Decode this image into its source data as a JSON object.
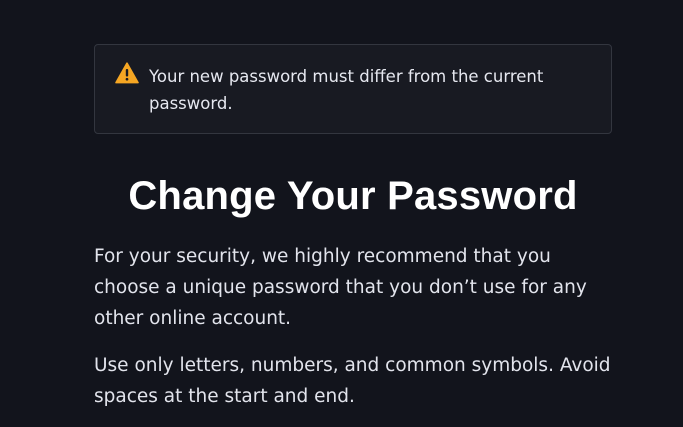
{
  "alert": {
    "icon": "warning-triangle-icon",
    "icon_color": "#f5a623",
    "message": "Your new password must differ from the current password."
  },
  "heading": {
    "title": "Change Your Password"
  },
  "body": {
    "paragraph_1": "For your security, we highly recommend that you choose a unique password that you don’t use for any other online account.",
    "paragraph_2": "Use only letters, numbers, and common symbols. Avoid spaces at the start and end."
  },
  "colors": {
    "background": "#12141c",
    "alert_background": "#181a22",
    "alert_border": "#33363f",
    "text": "#e2e4ec",
    "heading": "#ffffff"
  }
}
